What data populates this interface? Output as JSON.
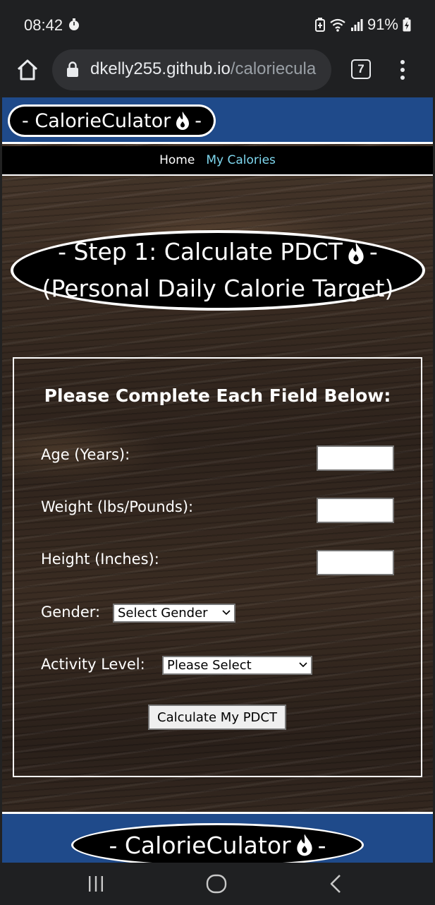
{
  "status_bar": {
    "time": "08:42",
    "battery": "91%"
  },
  "browser": {
    "url_host": "dkelly255.github.io",
    "url_path": "/caloriecula",
    "tab_count": "7"
  },
  "site": {
    "brand": "- CalorieCulator",
    "brand_suffix": "-",
    "nav": {
      "home": "Home",
      "my_calories": "My Calories"
    },
    "step_title_line1": "- Step 1: Calculate PDCT",
    "step_title_line1_suffix": "-",
    "step_title_line2": "(Personal Daily Calorie Target)"
  },
  "form": {
    "heading": "Please Complete Each Field Below:",
    "age_label": "Age (Years):",
    "weight_label": "Weight (lbs/Pounds):",
    "height_label": "Height (Inches):",
    "gender_label": "Gender:",
    "gender_selected": "Select Gender",
    "activity_label": "Activity Level:",
    "activity_selected": "Please Select",
    "submit_label": "Calculate My PDCT"
  },
  "footer": {
    "brand": "- CalorieCulator",
    "brand_suffix": "-"
  },
  "colors": {
    "brand_blue": "#1f4a8a",
    "nav_active": "#7fd8ef",
    "system_bar": "#1f2022"
  }
}
